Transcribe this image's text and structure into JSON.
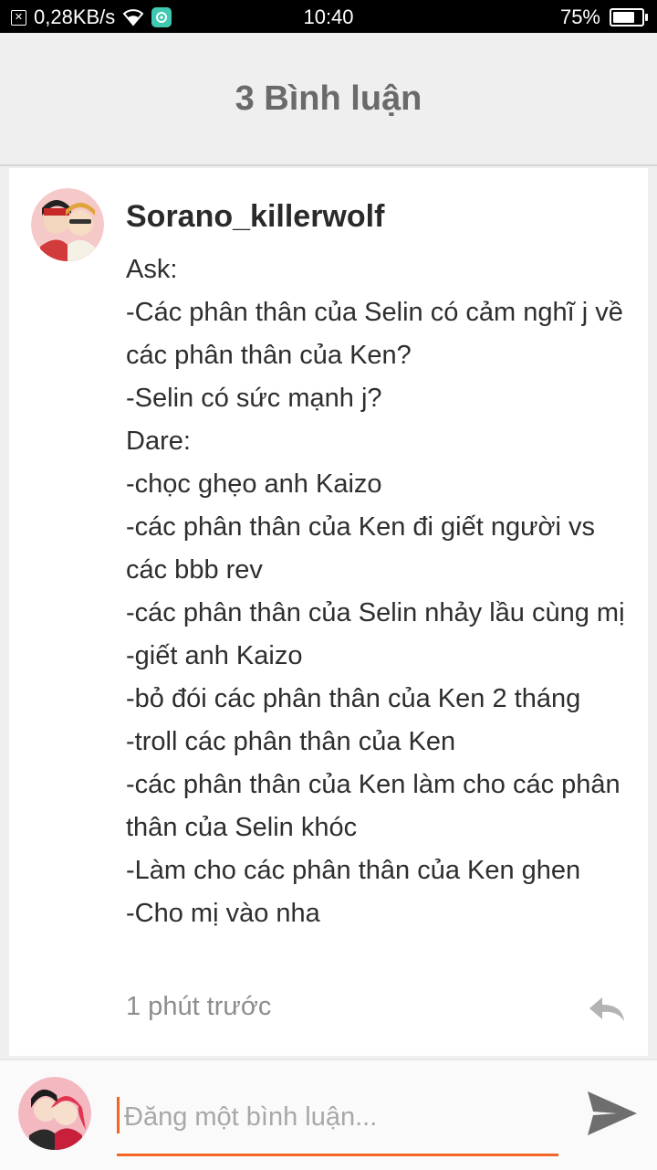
{
  "status_bar": {
    "network_speed": "0,28KB/s",
    "time": "10:40",
    "battery_percent": "75%",
    "battery_level": 0.75,
    "icons": [
      "notification-icon",
      "wifi-icon",
      "app-icon",
      "battery-icon"
    ]
  },
  "header": {
    "title": "3 Bình luận"
  },
  "comment": {
    "author": "Sorano_killerwolf",
    "lines": [
      "Ask:",
      "-Các phân thân của Selin có cảm nghĩ j về các phân thân của Ken?",
      "-Selin có sức mạnh j?",
      "Dare:",
      "-chọc ghẹo anh Kaizo",
      "-các phân thân của Ken đi giết người vs các bbb rev",
      "-các phân thân của Selin nhảy lầu cùng mị",
      "-giết anh Kaizo",
      "-bỏ đói các phân thân của Ken 2 tháng",
      "-troll các phân thân của Ken",
      "-các phân thân của Ken làm cho các phân thân của Selin khóc",
      "-Làm cho các phân thân của Ken ghen",
      "-Cho mị vào nha"
    ],
    "timestamp": "1 phút trước"
  },
  "composer": {
    "placeholder": "Đăng một bình luận...",
    "value": ""
  },
  "colors": {
    "accent": "#f26522",
    "header_bg": "#efefef",
    "title_gray": "#6a6a6a",
    "muted_gray": "#8d8d8d"
  }
}
